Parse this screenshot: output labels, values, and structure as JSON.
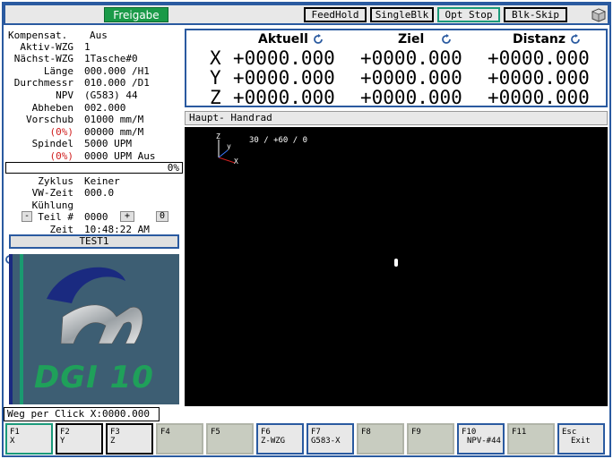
{
  "topbar": {
    "freigabe": "Freigabe",
    "buttons": [
      "FeedHold",
      "SingleBlk",
      "Opt Stop",
      "Blk-Skip"
    ]
  },
  "info": {
    "rows": [
      {
        "label": "Kompensat.",
        "value": "Aus"
      },
      {
        "label": "Aktiv-WZG",
        "value": "1"
      },
      {
        "label": "Nächst-WZG",
        "value": "1Tasche#0"
      },
      {
        "label": "Länge",
        "value": "000.000 /H1"
      },
      {
        "label": "Durchmessr",
        "value": "010.000 /D1"
      },
      {
        "label": "NPV",
        "value": "(G583) 44"
      },
      {
        "label": "Abheben",
        "value": "002.000"
      },
      {
        "label": "Vorschub",
        "value": "01000 mm/M"
      },
      {
        "label": "(0%)",
        "value": "00000 mm/M"
      },
      {
        "label": "Spindel",
        "value": "5000 UPM"
      },
      {
        "label": "(0%)",
        "value": "0000 UPM Aus"
      }
    ],
    "progress": "0%",
    "zyklus_label": "Zyklus",
    "zyklus_value": "Keiner",
    "vwzeit_label": "VW-Zeit",
    "vwzeit_value": "000.0",
    "kuehlung_label": "Kühlung",
    "teil_minus": "-",
    "teil_label": "Teil #",
    "teil_value": "0000",
    "teil_plus": "+",
    "teil_reset": "0",
    "zeit_label": "Zeit",
    "zeit_value": "10:48:22 AM",
    "program": "TEST1"
  },
  "logo": {
    "text": "DGI 10"
  },
  "position": {
    "headers": [
      "Aktuell",
      "Ziel",
      "Distanz"
    ],
    "axes": [
      {
        "axis": "X",
        "aktuell": "+0000.000",
        "ziel": "+0000.000",
        "distanz": "+0000.000"
      },
      {
        "axis": "Y",
        "aktuell": "+0000.000",
        "ziel": "+0000.000",
        "distanz": "+0000.000"
      },
      {
        "axis": "Z",
        "aktuell": "+0000.000",
        "ziel": "+0000.000",
        "distanz": "+0000.000"
      }
    ]
  },
  "handrad": {
    "label": "Haupt- Handrad"
  },
  "canvas": {
    "view_angles": "30 / +60 / 0",
    "axis_x": "X",
    "axis_y": "y",
    "axis_z": "Z"
  },
  "weg": {
    "text": "Weg per Click X:0000.000"
  },
  "fkeys": [
    {
      "key": "F1",
      "label": "X"
    },
    {
      "key": "F2",
      "label": "Y"
    },
    {
      "key": "F3",
      "label": "Z"
    },
    {
      "key": "F4",
      "label": ""
    },
    {
      "key": "F5",
      "label": ""
    },
    {
      "key": "F6",
      "label": "Z-WZG"
    },
    {
      "key": "F7",
      "label": "G583-X"
    },
    {
      "key": "F8",
      "label": ""
    },
    {
      "key": "F9",
      "label": ""
    },
    {
      "key": "F10",
      "label": "NPV-#44"
    },
    {
      "key": "F11",
      "label": ""
    },
    {
      "key": "Esc",
      "label": "Exit"
    }
  ]
}
